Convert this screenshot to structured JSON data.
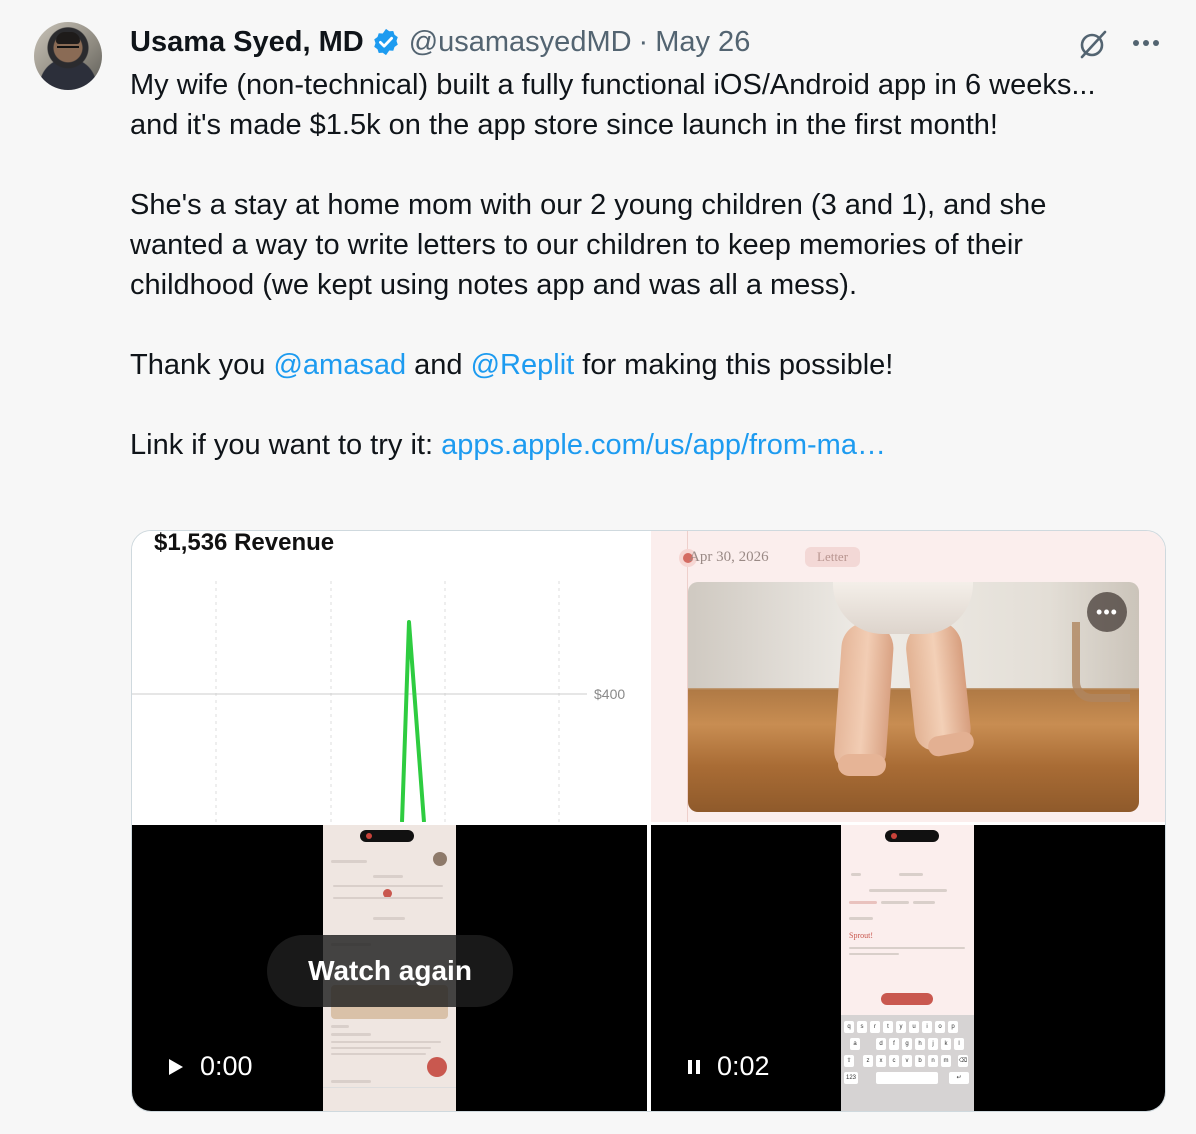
{
  "author": {
    "name": "Usama Syed, MD",
    "handle": "@usamasyedMD",
    "separator": "·",
    "date": "May 26"
  },
  "tweet": {
    "p1": "My wife (non-technical) built a fully functional iOS/Android app in 6 weeks... and it's made $1.5k on the app store since launch in the first month!",
    "p2": "She's a stay at home mom with our 2 young children (3 and 1), and she wanted a way to write letters to our children to keep memories of their childhood (we kept using notes app and was all a mess).",
    "p3_before": "Thank you ",
    "mention1": "@amasad",
    "p3_mid": " and ",
    "mention2": "@Replit",
    "p3_after": " for making this possible!",
    "p4_before": "Link if you want to try it: ",
    "link": "apps.apple.com/us/app/from-ma…"
  },
  "media": {
    "revenue_title": "$1,536 Revenue",
    "ytick_label": "$400",
    "entry_date": "Apr 30, 2026",
    "entry_badge": "Letter",
    "video1": {
      "overlay": "Watch again",
      "time": "0:00",
      "state": "play-icon"
    },
    "video2": {
      "time": "0:02",
      "state": "pause-icon"
    }
  },
  "chart_data": {
    "type": "line",
    "title": "$1,536 Revenue",
    "y_tick_labels": [
      "$400"
    ],
    "series_color": "#2ecc40",
    "grid": true
  },
  "colors": {
    "link": "#1d9bf0",
    "verified": "#1d9bf0",
    "secondary_text": "#536471",
    "revenue_line": "#2ecc40"
  },
  "icons": [
    "verified-badge-icon",
    "grok-icon",
    "more-icon",
    "play-icon",
    "pause-icon"
  ]
}
